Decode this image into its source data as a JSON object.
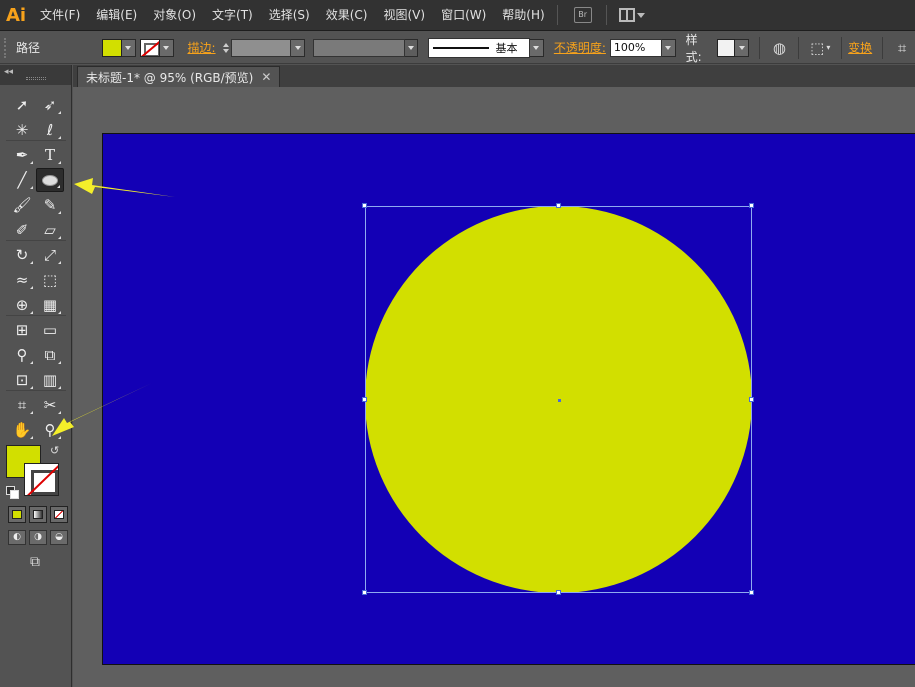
{
  "app": {
    "logo": "Ai"
  },
  "menu": {
    "items": [
      "文件(F)",
      "编辑(E)",
      "对象(O)",
      "文字(T)",
      "选择(S)",
      "效果(C)",
      "视图(V)",
      "窗口(W)",
      "帮助(H)"
    ],
    "bridge_label": "Br"
  },
  "control": {
    "selection_label": "路径",
    "stroke_label": "描边:",
    "stroke_style_label": "基本",
    "opacity_label": "不透明度:",
    "opacity_value": "100%",
    "style_label": "样式:",
    "transform_label": "变换"
  },
  "document": {
    "tab_title": "未标题-1* @ 95% (RGB/预览)",
    "close_glyph": "✕"
  },
  "colors": {
    "fill": "#d2df00",
    "artboard": "#1300b5",
    "accent_orange": "#f7a21b",
    "annotation_arrow": "#f4ef2a"
  },
  "tools": [
    [
      "selection-icon",
      "direct-selection-icon"
    ],
    [
      "magic-wand-icon",
      "lasso-icon"
    ],
    [
      "pen-icon",
      "type-icon"
    ],
    [
      "line-segment-icon",
      "ellipse-icon"
    ],
    [
      "paintbrush-icon",
      "pencil-icon"
    ],
    [
      "blob-brush-icon",
      "eraser-icon"
    ],
    [
      "rotate-icon",
      "scale-icon"
    ],
    [
      "warp-icon",
      "free-transform-icon"
    ],
    [
      "shape-builder-icon",
      "perspective-grid-icon"
    ],
    [
      "mesh-icon",
      "gradient-icon"
    ],
    [
      "eyedropper-icon",
      "blend-icon"
    ],
    [
      "symbol-sprayer-icon",
      "column-graph-icon"
    ],
    [
      "artboard-icon",
      "slice-icon"
    ],
    [
      "hand-icon",
      "zoom-icon"
    ]
  ],
  "type_tool_glyph": "T",
  "selected_tool": "ellipse-icon",
  "annotations": [
    "arrow pointing to ellipse tool",
    "arrow pointing to zoom/fill area"
  ]
}
